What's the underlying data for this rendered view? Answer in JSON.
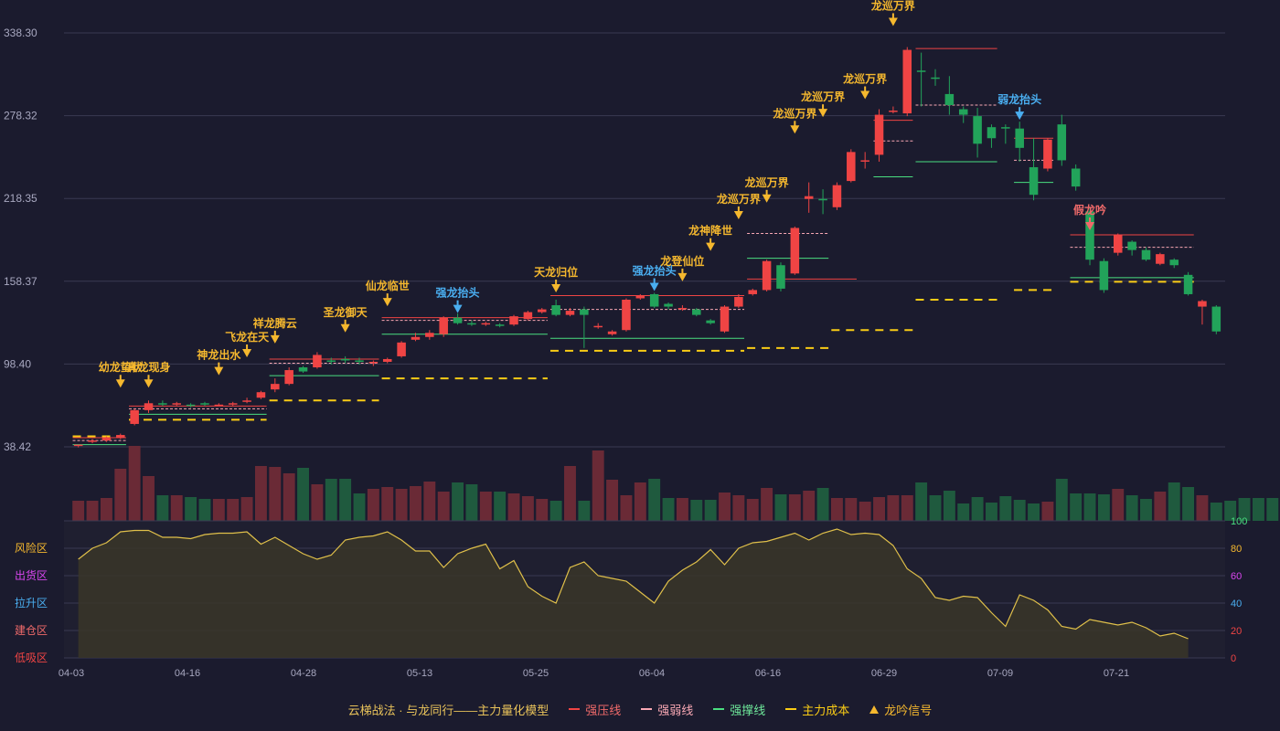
{
  "chart_data": {
    "type": "candlestick",
    "price_axis": {
      "ticks": [
        "338.30",
        "278.32",
        "218.35",
        "158.37",
        "98.40",
        "38.42"
      ],
      "ylim": [
        38.42,
        338.3
      ]
    },
    "x_axis": {
      "dates": [
        "04-03",
        "04-16",
        "04-28",
        "05-13",
        "05-25",
        "06-04",
        "06-16",
        "06-29",
        "07-09",
        "07-21"
      ]
    },
    "candles": [
      [
        40,
        40,
        39,
        38,
        0
      ],
      [
        42,
        43,
        44,
        41,
        0
      ],
      [
        43,
        45,
        46,
        42,
        0
      ],
      [
        45,
        47,
        48,
        44,
        0
      ],
      [
        55,
        65,
        66,
        54,
        0
      ],
      [
        65,
        70,
        72,
        63,
        0
      ],
      [
        70,
        70,
        72,
        68,
        1
      ],
      [
        69,
        70,
        71,
        68,
        0
      ],
      [
        68,
        69,
        70,
        67,
        1
      ],
      [
        70,
        70,
        71,
        68,
        1
      ],
      [
        69,
        69,
        70,
        68,
        0
      ],
      [
        69,
        70,
        71,
        68,
        0
      ],
      [
        71,
        72,
        74,
        70,
        0
      ],
      [
        74,
        78,
        79,
        73,
        0
      ],
      [
        80,
        84,
        88,
        78,
        0
      ],
      [
        84,
        94,
        96,
        83,
        0
      ],
      [
        93,
        96,
        97,
        92,
        1
      ],
      [
        96,
        105,
        107,
        95,
        0
      ],
      [
        101,
        101,
        103,
        98,
        1
      ],
      [
        102,
        102,
        104,
        99,
        1
      ],
      [
        101,
        101,
        103,
        98,
        1
      ],
      [
        99,
        100,
        101,
        97,
        0
      ],
      [
        100,
        102,
        103,
        99,
        0
      ],
      [
        104,
        114,
        115,
        103,
        0
      ],
      [
        116,
        118,
        121,
        115,
        0
      ],
      [
        118,
        121,
        123,
        116,
        0
      ],
      [
        120,
        132,
        133,
        118,
        0
      ],
      [
        132,
        128,
        135,
        127,
        1
      ],
      [
        128,
        128,
        130,
        126,
        1
      ],
      [
        128,
        128,
        129,
        126,
        0
      ],
      [
        127,
        126,
        128,
        125,
        1
      ],
      [
        127,
        133,
        134,
        126,
        0
      ],
      [
        131,
        136,
        137,
        130,
        0
      ],
      [
        136,
        138,
        139,
        135,
        0
      ],
      [
        141,
        134,
        145,
        133,
        1
      ],
      [
        134,
        137,
        139,
        133,
        0
      ],
      [
        138,
        134,
        140,
        110,
        1
      ],
      [
        126,
        126,
        128,
        124,
        0
      ],
      [
        120,
        122,
        123,
        119,
        0
      ],
      [
        123,
        145,
        146,
        122,
        0
      ],
      [
        146,
        148,
        149,
        145,
        0
      ],
      [
        149,
        140,
        150,
        139,
        1
      ],
      [
        142,
        140,
        143,
        138,
        1
      ],
      [
        139,
        138,
        141,
        137,
        0
      ],
      [
        138,
        134,
        139,
        133,
        1
      ],
      [
        130,
        128,
        131,
        127,
        1
      ],
      [
        122,
        140,
        141,
        121,
        0
      ],
      [
        140,
        147,
        149,
        139,
        0
      ],
      [
        149,
        152,
        153,
        148,
        0
      ],
      [
        152,
        173,
        174,
        151,
        0
      ],
      [
        170,
        153,
        172,
        151,
        1
      ],
      [
        164,
        197,
        198,
        163,
        0
      ],
      [
        218,
        220,
        230,
        208,
        0
      ],
      [
        218,
        218,
        225,
        207,
        1
      ],
      [
        212,
        228,
        230,
        210,
        0
      ],
      [
        231,
        252,
        254,
        230,
        0
      ],
      [
        246,
        246,
        252,
        240,
        0
      ],
      [
        250,
        279,
        283,
        245,
        0
      ],
      [
        282,
        282,
        285,
        280,
        0
      ],
      [
        280,
        326,
        328,
        278,
        0
      ],
      [
        311,
        311,
        324,
        285,
        1
      ],
      [
        306,
        306,
        312,
        300,
        1
      ],
      [
        294,
        286,
        307,
        279,
        1
      ],
      [
        283,
        279,
        285,
        273,
        1
      ],
      [
        278,
        258,
        284,
        248,
        1
      ],
      [
        262,
        270,
        272,
        255,
        1
      ],
      [
        270,
        270,
        272,
        258,
        1
      ],
      [
        269,
        255,
        274,
        245,
        1
      ],
      [
        241,
        221,
        262,
        217,
        1
      ],
      [
        240,
        261,
        262,
        238,
        0
      ],
      [
        272,
        246,
        279,
        242,
        1
      ],
      [
        240,
        227,
        243,
        224,
        1
      ],
      [
        209,
        174,
        212,
        170,
        1
      ],
      [
        173,
        152,
        175,
        150,
        1
      ],
      [
        192,
        179,
        193,
        177,
        0
      ],
      [
        187,
        181,
        188,
        177,
        1
      ],
      [
        181,
        174,
        183,
        173,
        1
      ],
      [
        171,
        178,
        179,
        170,
        0
      ],
      [
        174,
        170,
        175,
        168,
        1
      ],
      [
        163,
        149,
        165,
        148,
        1
      ],
      [
        144,
        140,
        145,
        127,
        0
      ],
      [
        140,
        122,
        141,
        120,
        1
      ]
    ],
    "volume": [
      22,
      22,
      25,
      57,
      82,
      49,
      28,
      28,
      26,
      24,
      24,
      24,
      26,
      60,
      59,
      52,
      58,
      40,
      46,
      46,
      30,
      35,
      37,
      35,
      38,
      43,
      32,
      42,
      40,
      32,
      32,
      30,
      27,
      24,
      22,
      60,
      22,
      77,
      45,
      28,
      42,
      46,
      25,
      25,
      23,
      23,
      31,
      28,
      24,
      36,
      29,
      29,
      33,
      36,
      25,
      25,
      21,
      26,
      28,
      28,
      42,
      28,
      33,
      19,
      26,
      20,
      27,
      23,
      19,
      21,
      46,
      30,
      30,
      29,
      35,
      28,
      24,
      32,
      42,
      37,
      28,
      20,
      22,
      25,
      25,
      25,
      24,
      24
    ],
    "signals": [
      {
        "i": 3,
        "label": "幼龙蛰伏",
        "kind": "strong",
        "y": 76
      },
      {
        "i": 5,
        "label": "真龙现身",
        "kind": "strong",
        "y": 76
      },
      {
        "i": 10,
        "label": "神龙出水",
        "kind": "strong",
        "y": 85
      },
      {
        "i": 12,
        "label": "飞龙在天",
        "kind": "strong",
        "y": 98
      },
      {
        "i": 14,
        "label": "祥龙腾云",
        "kind": "strong",
        "y": 108
      },
      {
        "i": 19,
        "label": "圣龙御天",
        "kind": "strong",
        "y": 116
      },
      {
        "i": 22,
        "label": "仙龙临世",
        "kind": "strong",
        "y": 135
      },
      {
        "i": 27,
        "label": "强龙抬头",
        "kind": "blue",
        "y": 130
      },
      {
        "i": 34,
        "label": "天龙归位",
        "kind": "strong",
        "y": 145
      },
      {
        "i": 41,
        "label": "强龙抬头",
        "kind": "blue",
        "y": 146
      },
      {
        "i": 43,
        "label": "龙登仙位",
        "kind": "strong",
        "y": 153
      },
      {
        "i": 45,
        "label": "龙神降世",
        "kind": "strong",
        "y": 175
      },
      {
        "i": 47,
        "label": "龙巡万界",
        "kind": "strong",
        "y": 198
      },
      {
        "i": 49,
        "label": "龙巡万界",
        "kind": "strong",
        "y": 210
      },
      {
        "i": 51,
        "label": "龙巡万界",
        "kind": "strong",
        "y": 260
      },
      {
        "i": 53,
        "label": "龙巡万界",
        "kind": "strong",
        "y": 272
      },
      {
        "i": 56,
        "label": "龙巡万界",
        "kind": "strong",
        "y": 285
      },
      {
        "i": 58,
        "label": "龙巡万界",
        "kind": "strong",
        "y": 338
      },
      {
        "i": 67,
        "label": "弱龙抬头",
        "kind": "blue",
        "y": 270
      },
      {
        "i": 72,
        "label": "假龙吟",
        "kind": "red",
        "y": 190
      }
    ],
    "levels": {
      "pressure": [
        [
          0,
          4,
          45
        ],
        [
          4,
          14,
          68
        ],
        [
          14,
          22,
          102
        ],
        [
          22,
          34,
          132
        ],
        [
          34,
          48,
          148
        ],
        [
          48,
          56,
          160
        ],
        [
          57,
          60,
          275
        ],
        [
          60,
          66,
          327
        ],
        [
          67,
          70,
          262
        ],
        [
          71,
          80,
          192
        ]
      ],
      "weak": [
        [
          0,
          4,
          43
        ],
        [
          4,
          14,
          66
        ],
        [
          14,
          22,
          99
        ],
        [
          22,
          34,
          130
        ],
        [
          34,
          48,
          138
        ],
        [
          48,
          54,
          193
        ],
        [
          57,
          60,
          260
        ],
        [
          60,
          66,
          286
        ],
        [
          67,
          70,
          246
        ],
        [
          71,
          80,
          183
        ]
      ],
      "support": [
        [
          0,
          4,
          40
        ],
        [
          4,
          14,
          62
        ],
        [
          14,
          22,
          90
        ],
        [
          22,
          34,
          120
        ],
        [
          34,
          48,
          117
        ],
        [
          48,
          54,
          175
        ],
        [
          57,
          60,
          234
        ],
        [
          60,
          66,
          245
        ],
        [
          67,
          70,
          230
        ],
        [
          71,
          80,
          161
        ]
      ],
      "cost": [
        [
          0,
          4,
          46
        ],
        [
          4,
          14,
          58
        ],
        [
          14,
          22,
          72
        ],
        [
          22,
          34,
          88
        ],
        [
          34,
          48,
          108
        ],
        [
          48,
          54,
          110
        ],
        [
          54,
          60,
          123
        ],
        [
          60,
          66,
          145
        ],
        [
          67,
          70,
          152
        ],
        [
          71,
          80,
          158
        ]
      ]
    },
    "oscillator": {
      "ylim": [
        0,
        100
      ],
      "ticks": [
        "100",
        "80",
        "60",
        "40",
        "20",
        "0"
      ],
      "zones": [
        "风险区",
        "出货区",
        "拉升区",
        "建仓区",
        "低吸区"
      ],
      "values": [
        72,
        80,
        84,
        92,
        93,
        93,
        88,
        88,
        87,
        90,
        91,
        91,
        92,
        83,
        88,
        82,
        76,
        72,
        75,
        86,
        88,
        89,
        92,
        86,
        78,
        78,
        66,
        76,
        80,
        83,
        65,
        71,
        52,
        45,
        40,
        66,
        70,
        60,
        58,
        56,
        48,
        40,
        56,
        64,
        70,
        79,
        68,
        80,
        84,
        85,
        88,
        91,
        86,
        91,
        94,
        90,
        91,
        90,
        82,
        65,
        58,
        44,
        42,
        45,
        44,
        33,
        23,
        46,
        42,
        35,
        23,
        21,
        28,
        26,
        24,
        26,
        22,
        16,
        18,
        14
      ]
    },
    "legend": {
      "title": "云梯战法 · 与龙同行——主力量化模型",
      "items": [
        {
          "label": "强压线",
          "color": "#ef4444",
          "style": "solid"
        },
        {
          "label": "强弱线",
          "color": "#f9a8b4",
          "style": "dash"
        },
        {
          "label": "强撑线",
          "color": "#4ade80",
          "style": "solid"
        },
        {
          "label": "主力成本",
          "color": "#facc15",
          "style": "dash"
        },
        {
          "label": "龙吟信号",
          "color": "#f5b82e",
          "style": "triangle"
        }
      ]
    }
  },
  "colors": {
    "bg": "#1b1b2e",
    "up": "#ef4444",
    "down": "#22a35a",
    "signal": "#f5b82e",
    "blue": "#4aaef0",
    "red": "#ef6a6a",
    "grid": "#3a3a52",
    "osc_line": "#e0c04a"
  }
}
